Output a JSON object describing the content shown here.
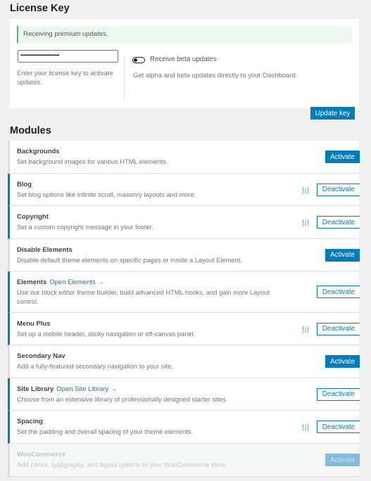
{
  "license": {
    "heading": "License Key",
    "notice": "Receiving premium updates.",
    "key_value": "••••••••••••••••••••••••",
    "key_help": "Enter your license key to activate updates.",
    "beta_label": "Receive beta updates",
    "beta_enabled": false,
    "beta_help": "Get alpha and beta updates directly to your Dashboard.",
    "update_button": "Update key"
  },
  "modules": {
    "heading": "Modules",
    "items": [
      {
        "title": "Backgrounds",
        "desc": "Set background images for various HTML elements.",
        "active": false,
        "button": "Activate",
        "settings": false,
        "link": ""
      },
      {
        "title": "Blog",
        "desc": "Set blog options like infinite scroll, masonry layouts and more.",
        "active": true,
        "button": "Deactivate",
        "settings": true,
        "link": ""
      },
      {
        "title": "Copyright",
        "desc": "Set a custom copyright message in your footer.",
        "active": true,
        "button": "Deactivate",
        "settings": true,
        "link": ""
      },
      {
        "title": "Disable Elements",
        "desc": "Disable default theme elements on specific pages or inside a Layout Element.",
        "active": false,
        "button": "Activate",
        "settings": false,
        "link": ""
      },
      {
        "title": "Elements",
        "desc": "Use our block editor theme builder, build advanced HTML hooks, and gain more Layout control.",
        "active": true,
        "button": "Deactivate",
        "settings": false,
        "link": "Open Elements →"
      },
      {
        "title": "Menu Plus",
        "desc": "Set up a mobile header, sticky navigation or off-canvas panel.",
        "active": true,
        "button": "Deactivate",
        "settings": true,
        "link": ""
      },
      {
        "title": "Secondary Nav",
        "desc": "Add a fully-featured secondary navigation to your site.",
        "active": false,
        "button": "Activate",
        "settings": false,
        "link": ""
      },
      {
        "title": "Site Library",
        "desc": "Choose from an extensive library of professionally designed starter sites.",
        "active": true,
        "button": "Deactivate",
        "settings": false,
        "link": "Open Site Library →"
      },
      {
        "title": "Spacing",
        "desc": "Set the padding and overall spacing of your theme elements.",
        "active": true,
        "button": "Deactivate",
        "settings": true,
        "link": ""
      },
      {
        "title": "WooCommerce",
        "desc": "Add colors, typography, and layout options to your WooCommerce store.",
        "active": false,
        "disabled": true,
        "button": "Activate",
        "settings": false,
        "link": ""
      }
    ]
  },
  "colors": {
    "accent": "#007cba",
    "success": "#4ab866"
  }
}
